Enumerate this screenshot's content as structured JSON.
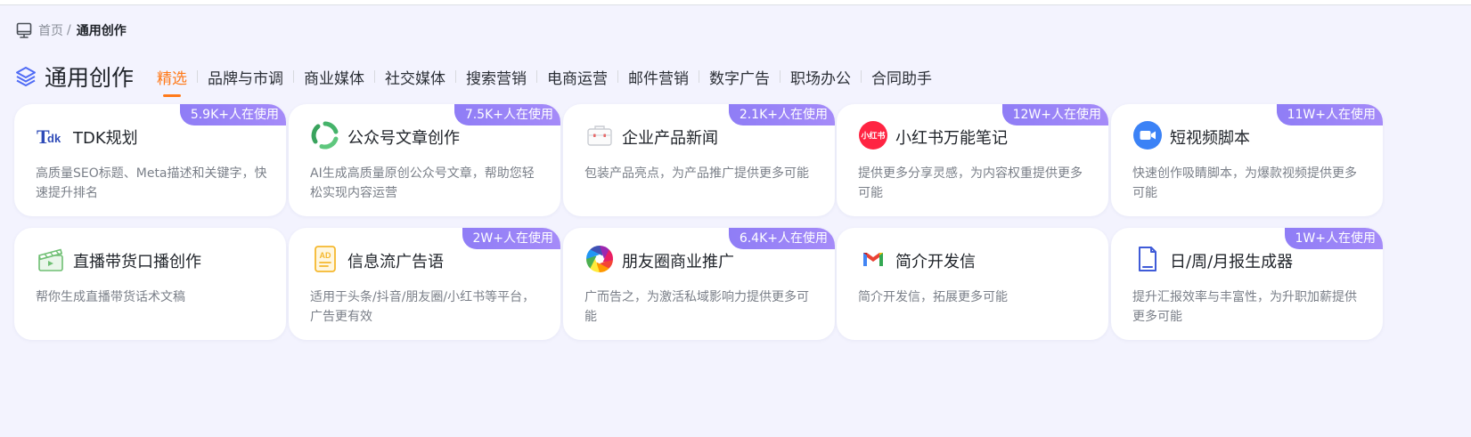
{
  "breadcrumb": {
    "home": "首页",
    "separator": "/",
    "current": "通用创作"
  },
  "heading": {
    "title": "通用创作",
    "icon": "layers-icon"
  },
  "tabs": [
    "精选",
    "品牌与市调",
    "商业媒体",
    "社交媒体",
    "搜索营销",
    "电商运营",
    "邮件营销",
    "数字广告",
    "职场办公",
    "合同助手"
  ],
  "active_tab": "精选",
  "cards": [
    {
      "title": "TDK规划",
      "badge": "5.9K+人在使用",
      "desc": "高质量SEO标题、Meta描述和关键字，快速提升排名",
      "icon": "tdk-icon"
    },
    {
      "title": "公众号文章创作",
      "badge": "7.5K+人在使用",
      "desc": "AI生成高质量原创公众号文章，帮助您轻松实现内容运营",
      "icon": "wechat-official-icon"
    },
    {
      "title": "企业产品新闻",
      "badge": "2.1K+人在使用",
      "desc": "包装产品亮点，为产品推广提供更多可能",
      "icon": "briefcase-icon"
    },
    {
      "title": "小红书万能笔记",
      "badge": "12W+人在使用",
      "desc": "提供更多分享灵感，为内容权重提供更多可能",
      "icon": "xiaohongshu-icon",
      "icon_text": "小红书"
    },
    {
      "title": "短视频脚本",
      "badge": "11W+人在使用",
      "desc": "快速创作吸睛脚本，为爆款视频提供更多可能",
      "icon": "video-camera-icon"
    },
    {
      "title": "直播带货口播创作",
      "badge": "",
      "desc": "帮你生成直播带货话术文稿",
      "icon": "clapperboard-icon"
    },
    {
      "title": "信息流广告语",
      "badge": "2W+人在使用",
      "desc": "适用于头条/抖音/朋友圈/小红书等平台，广告更有效",
      "icon": "ad-document-icon",
      "icon_text": "AD"
    },
    {
      "title": "朋友圈商业推广",
      "badge": "6.4K+人在使用",
      "desc": "广而告之，为激活私域影响力提供更多可能",
      "icon": "moments-aperture-icon"
    },
    {
      "title": "简介开发信",
      "badge": "",
      "desc": "简介开发信，拓展更多可能",
      "icon": "gmail-icon"
    },
    {
      "title": "日/周/月报生成器",
      "badge": "1W+人在使用",
      "desc": "提升汇报效率与丰富性，为升职加薪提供更多可能",
      "icon": "report-document-icon"
    }
  ],
  "colors": {
    "accent": "#ff7a1a",
    "badge": "#9b84f7",
    "background": "#f3f3fe"
  }
}
